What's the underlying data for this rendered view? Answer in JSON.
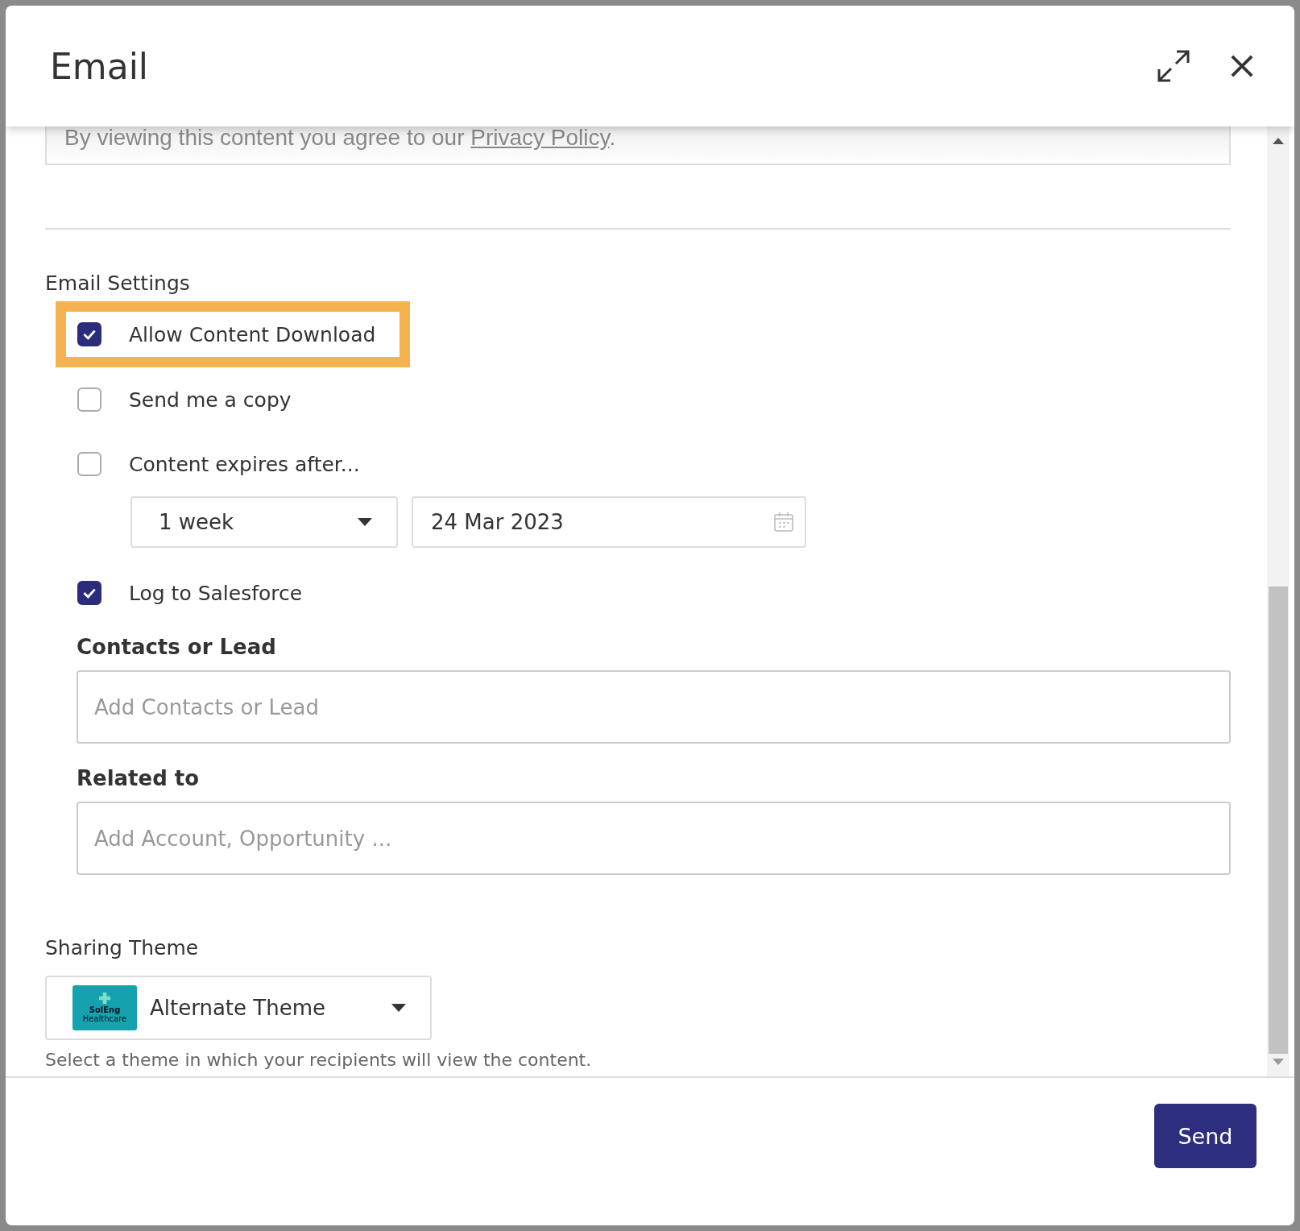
{
  "dialog": {
    "title": "Email"
  },
  "consent": {
    "text": "By viewing this content you agree to our ",
    "link": "Privacy Policy",
    "end": "."
  },
  "email_settings": {
    "heading": "Email Settings",
    "options": [
      {
        "label": "Allow Content Download",
        "checked": true,
        "highlighted": true
      },
      {
        "label": "Send me a copy",
        "checked": false,
        "highlighted": false
      },
      {
        "label": "Content expires after...",
        "checked": false,
        "highlighted": false
      }
    ],
    "expiry": {
      "period": "1 week",
      "date": "24 Mar 2023"
    },
    "salesforce": {
      "label": "Log to Salesforce",
      "checked": true
    },
    "fields": [
      {
        "label": "Contacts or Lead",
        "placeholder": "Add Contacts or Lead"
      },
      {
        "label": "Related to",
        "placeholder": "Add Account, Opportunity ..."
      }
    ]
  },
  "sharing_theme": {
    "heading": "Sharing Theme",
    "value": "Alternate Theme",
    "logo_lines": [
      "SolEng",
      "Healthcare"
    ],
    "hint": "Select a theme in which your recipients will view the content."
  },
  "buttons": {
    "send": "Send"
  }
}
